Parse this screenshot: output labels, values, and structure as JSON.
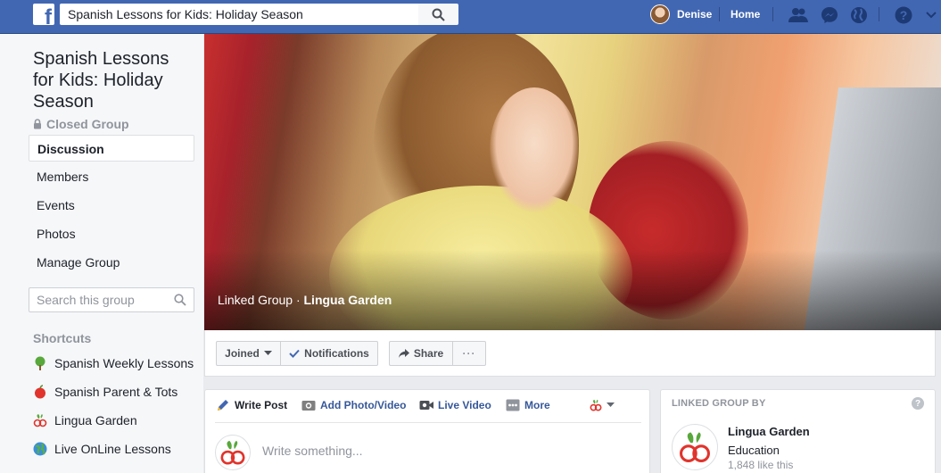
{
  "topbar": {
    "search_value": "Spanish Lessons for Kids: Holiday Season",
    "user_name": "Denise",
    "home_label": "Home",
    "icons": [
      "friends-icon",
      "messenger-icon",
      "globe-icon",
      "help-icon"
    ]
  },
  "sidebar": {
    "group_title": "Spanish Lessons for Kids: Holiday Season",
    "privacy": "Closed Group",
    "nav": [
      {
        "label": "Discussion",
        "active": true
      },
      {
        "label": "Members"
      },
      {
        "label": "Events"
      },
      {
        "label": "Photos"
      },
      {
        "label": "Manage Group"
      }
    ],
    "search_placeholder": "Search this group",
    "shortcuts_heading": "Shortcuts",
    "shortcuts": [
      {
        "label": "Spanish Weekly Lessons",
        "icon": "tree-icon"
      },
      {
        "label": "Spanish Parent & Tots",
        "icon": "apple-icon"
      },
      {
        "label": "Lingua Garden",
        "icon": "lingua-garden-logo-icon"
      },
      {
        "label": "Live OnLine Lessons",
        "icon": "earth-icon"
      }
    ]
  },
  "cover": {
    "caption_prefix": "Linked Group · ",
    "caption_group": "Lingua Garden"
  },
  "actions": {
    "joined": "Joined",
    "notifications": "Notifications",
    "share": "Share",
    "more": "···"
  },
  "composer": {
    "tabs": [
      "Write Post",
      "Add Photo/Video",
      "Live Video",
      "More"
    ],
    "placeholder": "Write something..."
  },
  "linked_card": {
    "heading": "LINKED GROUP BY",
    "help": "?",
    "name": "Lingua Garden",
    "category": "Education",
    "likes": "1,848 like this"
  },
  "colors": {
    "brand": "#4267b2",
    "link": "#365899",
    "background": "#e9ebee"
  }
}
